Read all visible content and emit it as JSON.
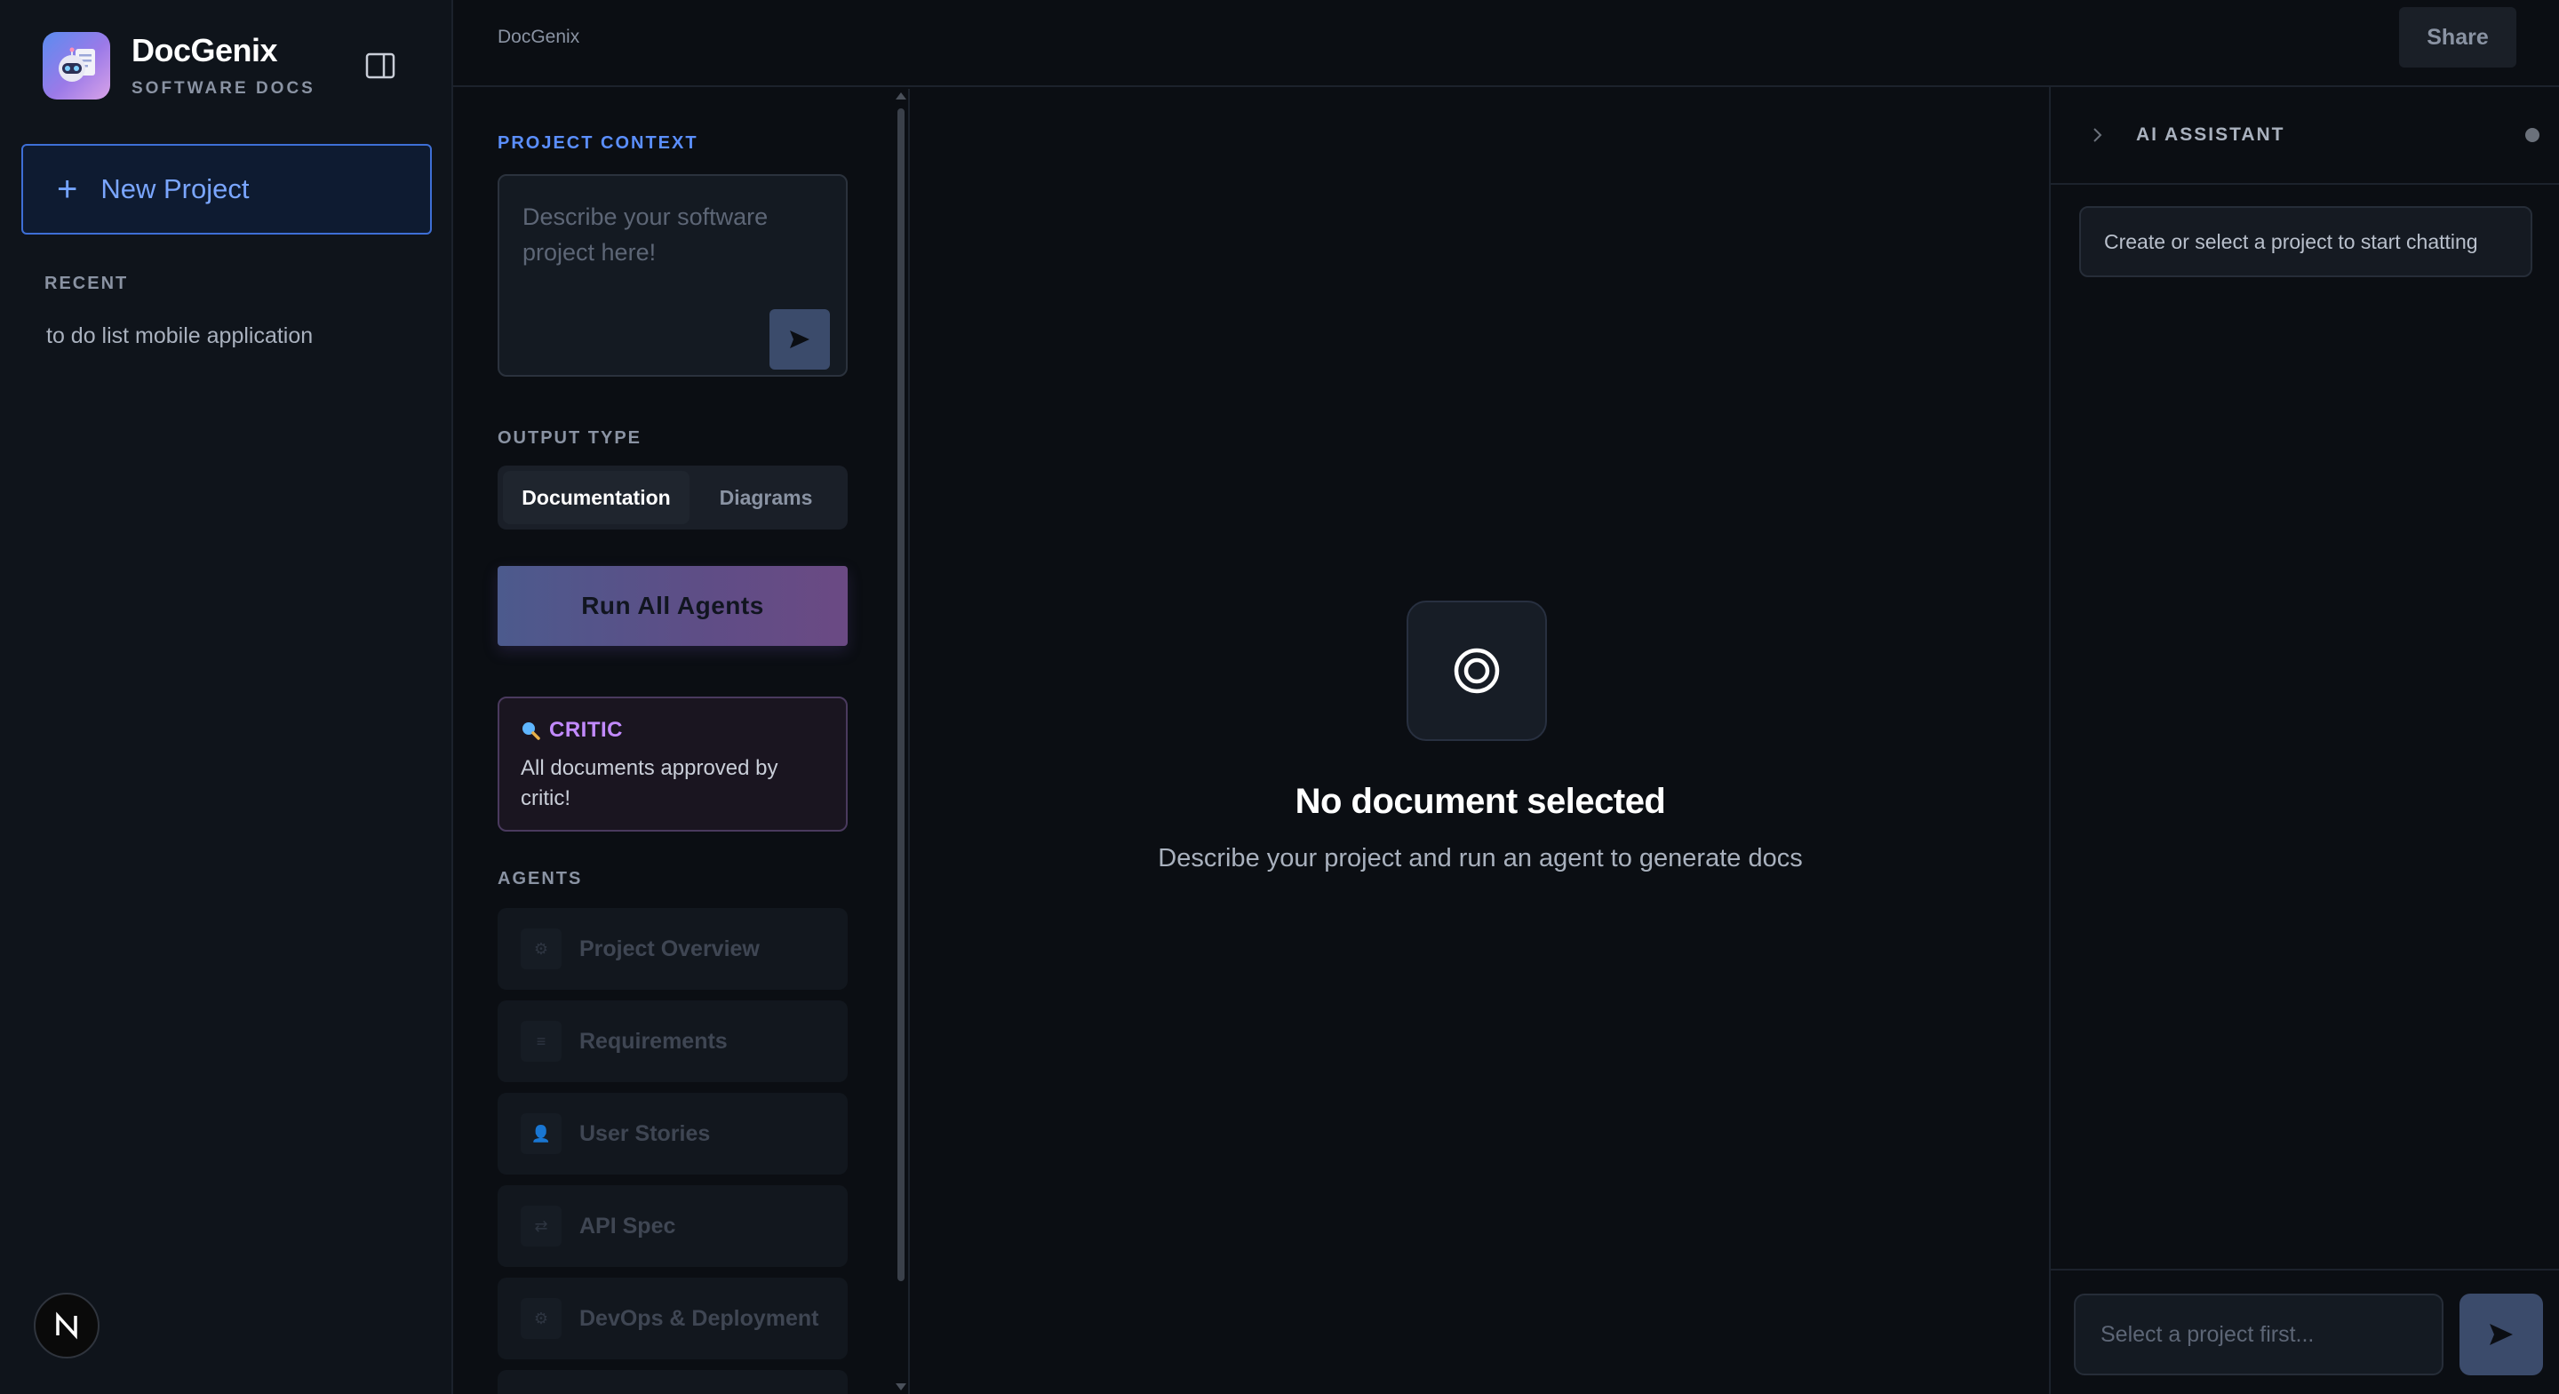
{
  "app": {
    "name": "DocGenix",
    "subtitle": "SOFTWARE DOCS"
  },
  "sidebar": {
    "new_project_label": "New Project",
    "recent_label": "RECENT",
    "recent_items": [
      "to do list mobile application"
    ],
    "badge_letter": "N"
  },
  "topbar": {
    "breadcrumb": "DocGenix",
    "share_label": "Share"
  },
  "controls": {
    "context_label": "PROJECT CONTEXT",
    "context_placeholder": "Describe your software project here!",
    "output_type_label": "OUTPUT TYPE",
    "output_types": [
      "Documentation",
      "Diagrams"
    ],
    "output_selected": "Documentation",
    "run_label": "Run All Agents",
    "critic": {
      "title": "CRITIC",
      "message": "All documents approved by critic!"
    },
    "agents_label": "AGENTS",
    "agents": [
      {
        "name": "Project Overview",
        "icon": "gear-icon",
        "glyph": "⚙"
      },
      {
        "name": "Requirements",
        "icon": "list-icon",
        "glyph": "≡"
      },
      {
        "name": "User Stories",
        "icon": "user-icon",
        "glyph": "👤"
      },
      {
        "name": "API Spec",
        "icon": "swap-icon",
        "glyph": "⇄"
      },
      {
        "name": "DevOps & Deployment",
        "icon": "settings-icon",
        "glyph": "⚙"
      }
    ]
  },
  "document": {
    "empty_title": "No document selected",
    "empty_subtitle": "Describe your project and run an agent to generate docs"
  },
  "assistant": {
    "title": "AI ASSISTANT",
    "notice": "Create or select a project to start chatting",
    "input_placeholder": "Select a project first..."
  },
  "colors": {
    "accent": "#5b8fff",
    "critic": "#c28aff",
    "background": "#0b0e13"
  }
}
